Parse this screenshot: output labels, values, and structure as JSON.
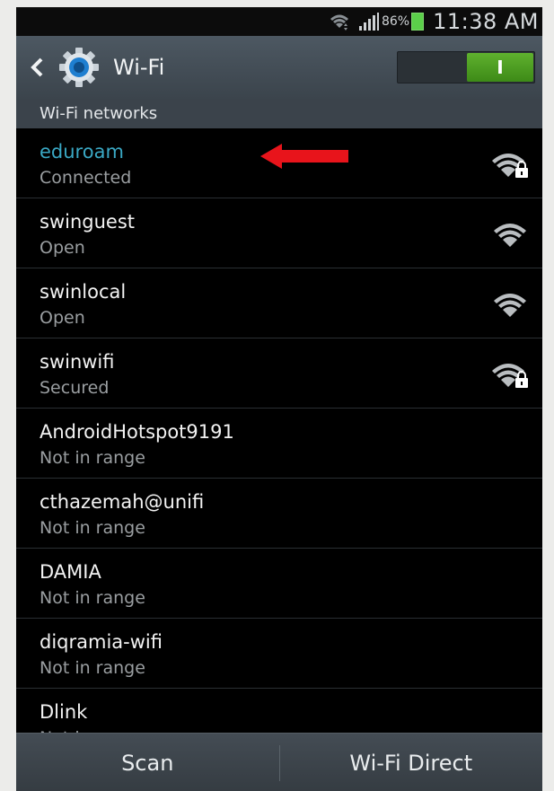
{
  "status_bar": {
    "battery_percent": "86%",
    "time": "11:38 AM",
    "icons": [
      "wifi-icon",
      "signal-icon",
      "battery-icon"
    ]
  },
  "action_bar": {
    "title": "Wi-Fi",
    "back_icon": "back-chevron-icon",
    "app_icon": "gear-icon",
    "toggle_label": "I",
    "toggle_state": "on"
  },
  "section_header": "Wi-Fi networks",
  "networks": [
    {
      "name": "eduroam",
      "status": "Connected",
      "signal_icon": "wifi-locked-icon"
    },
    {
      "name": "swinguest",
      "status": "Open",
      "signal_icon": "wifi-open-icon"
    },
    {
      "name": "swinlocal",
      "status": "Open",
      "signal_icon": "wifi-open-icon"
    },
    {
      "name": "swinwifi",
      "status": "Secured",
      "signal_icon": "wifi-locked-icon"
    },
    {
      "name": "AndroidHotspot9191",
      "status": "Not in range"
    },
    {
      "name": "cthazemah@unifi",
      "status": "Not in range"
    },
    {
      "name": "DAMIA",
      "status": "Not in range"
    },
    {
      "name": "diqramia-wifi",
      "status": "Not in range"
    },
    {
      "name": "Dlink",
      "status": "Not in range"
    }
  ],
  "bottom_bar": {
    "scan_label": "Scan",
    "wifi_direct_label": "Wi-Fi Direct"
  },
  "colors": {
    "accent_connected": "#3aa8c4",
    "toggle_on": "#4fa224",
    "annotation_arrow": "#e8141b"
  }
}
